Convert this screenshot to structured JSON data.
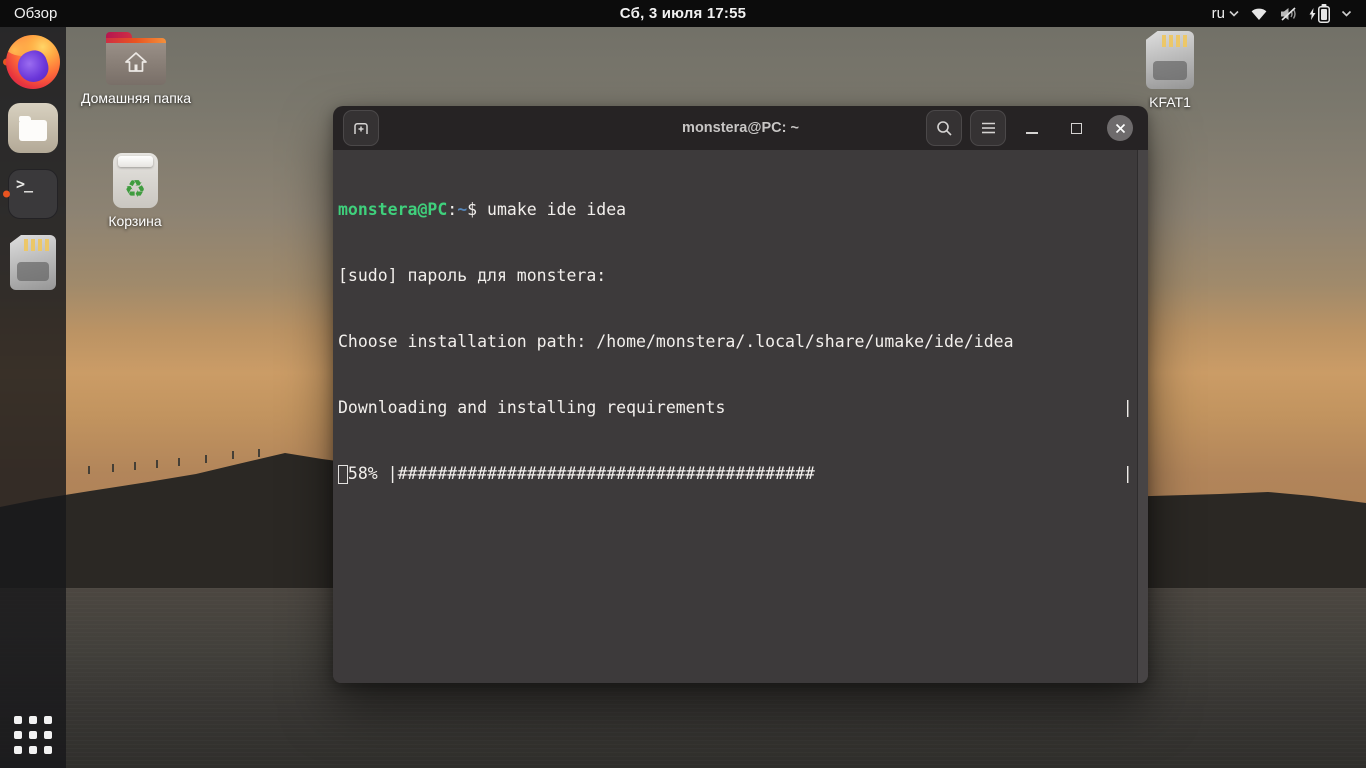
{
  "topbar": {
    "activities_label": "Обзор",
    "clock": "Сб, 3 июля  17:55",
    "keyboard_layout": "ru"
  },
  "dock": {
    "terminal_glyph": ">_"
  },
  "desktop": {
    "icons": [
      {
        "id": "home-folder",
        "label": "Домашняя папка"
      },
      {
        "id": "trash",
        "label": "Корзина",
        "recycle_glyph": "♻"
      },
      {
        "id": "usb-volume",
        "label": "KFAT1"
      }
    ]
  },
  "terminal": {
    "title": "monstera@PC: ~",
    "prompt": {
      "user": "monstera@PC",
      "sep": ":",
      "path": "~",
      "command": "$ umake ide idea"
    },
    "output": {
      "sudo_line": "[sudo] пароль для monstera: ",
      "path_line": "Choose installation path: /home/monstera/.local/share/umake/ide/idea",
      "status_line": "Downloading and installing requirements                                        |",
      "progress_line": "58% |##########################################                               |"
    },
    "progress_percent": 58
  },
  "colors": {
    "accent_orange": "#e95420",
    "prompt_green": "#3fd07c",
    "prompt_blue": "#5585b8",
    "terminal_bg": "#3d3a3b",
    "titlebar_bg": "#262324"
  }
}
